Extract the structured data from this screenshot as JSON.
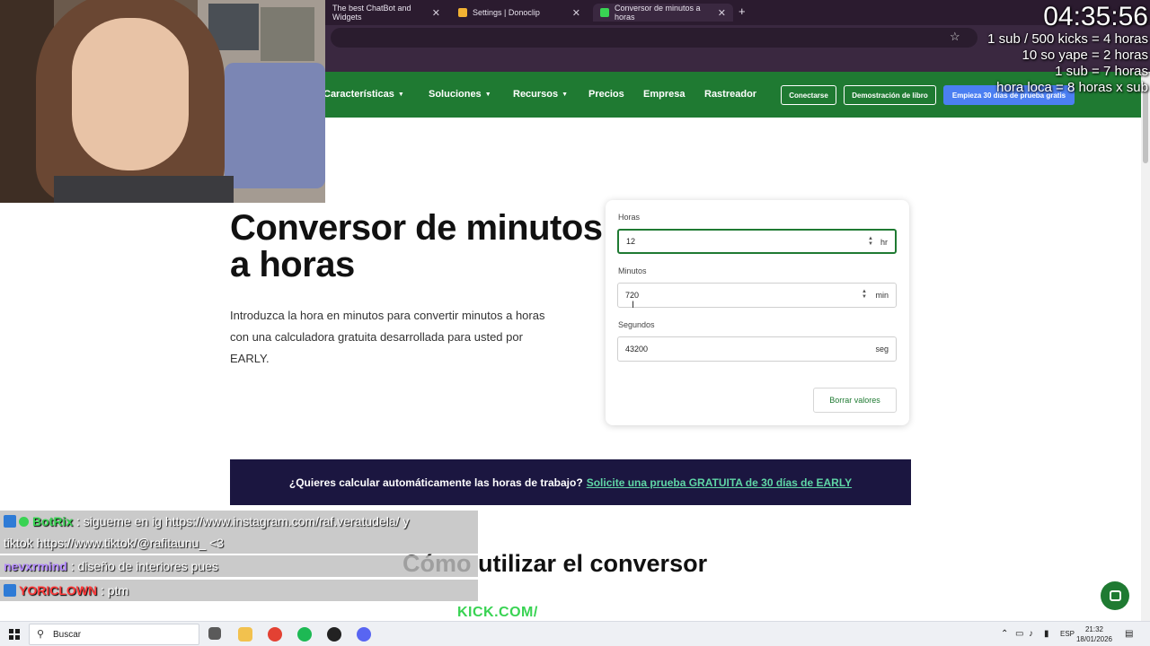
{
  "browser": {
    "tabs": [
      {
        "title": "The best ChatBot and Widgets",
        "favicon_color": "#3a2840"
      },
      {
        "title": "Settings | Donoclip",
        "favicon_color": "#f2b233"
      },
      {
        "title": "Conversor de minutos a horas",
        "favicon_color": "#39d353"
      }
    ],
    "close_glyph": "✕",
    "new_tab_glyph": "+",
    "star_glyph": "☆"
  },
  "nav": {
    "items": [
      {
        "label": "Características",
        "caret": "▼"
      },
      {
        "label": "Soluciones",
        "caret": "▼"
      },
      {
        "label": "Recursos",
        "caret": "▼"
      },
      {
        "label": "Precios"
      },
      {
        "label": "Empresa"
      },
      {
        "label": "Rastreador"
      }
    ],
    "connect_label": "Conectarse",
    "demo_label": "Demostración de libro",
    "trial_label": "Empieza 30 días de prueba gratis"
  },
  "hero": {
    "title": "Conversor de minutos a horas",
    "description": "Introduzca la hora en minutos para convertir minutos a horas con una calculadora gratuita desarrollada para usted por EARLY."
  },
  "calculator": {
    "hours_label": "Horas",
    "hours_value": "12",
    "hours_unit": "hr",
    "minutes_label": "Minutos",
    "minutes_value": "720",
    "minutes_unit": "min",
    "seconds_label": "Segundos",
    "seconds_value": "43200",
    "seconds_unit": "seg",
    "clear_label": "Borrar valores",
    "spin_up": "▲",
    "spin_down": "▼"
  },
  "cta": {
    "question": "¿Quieres calcular automáticamente las horas de trabajo?",
    "link": "Solicite una prueba GRATUITA de 30 días de EARLY"
  },
  "section": {
    "heading": "Cómo utilizar el conversor"
  },
  "overlay": {
    "clock": "04:35:56",
    "goals": [
      "1 sub / 500 kicks = 4 horas",
      "10 so yape = 2 horas",
      "1 sub = 7 horas",
      "hora loca = 8 horas x sub"
    ],
    "kick_text": "KICK.COM/"
  },
  "chat": [
    {
      "user": "BotRix",
      "user_color": "#39d353",
      "message": ": sigueme en ig https://www.instagram.com/raf.veratudela/ y",
      "verified": true
    },
    {
      "user": "",
      "user_color": "#ffffff",
      "message": "tiktok https://www.tiktok/@rafitaunu_ <3",
      "verified": false
    },
    {
      "user": "nevxrmind",
      "user_color": "#b58cff",
      "message": ": diseño de interiores pues",
      "verified": false
    },
    {
      "user": "YORICLOWN",
      "user_color": "#ff3b3b",
      "message": ": ptm",
      "verified": false
    }
  ],
  "taskbar": {
    "search_placeholder": "Buscar",
    "search_glyph": "⚲",
    "lang": "ESP",
    "time": "21:32",
    "date": "18/01/2026",
    "apps": [
      {
        "name": "task-view",
        "color": "#5a5a5a"
      },
      {
        "name": "file-explorer",
        "color": "#f2c14e"
      },
      {
        "name": "chrome",
        "color": "#e34133"
      },
      {
        "name": "spotify",
        "color": "#1db954"
      },
      {
        "name": "app-black",
        "color": "#222222"
      },
      {
        "name": "discord",
        "color": "#5865f2"
      }
    ]
  },
  "colors": {
    "brand_green": "#1f7a32",
    "cta_bg": "#1b1640",
    "cta_link": "#5fd6a6",
    "primary_blue": "#4b7ff2"
  }
}
